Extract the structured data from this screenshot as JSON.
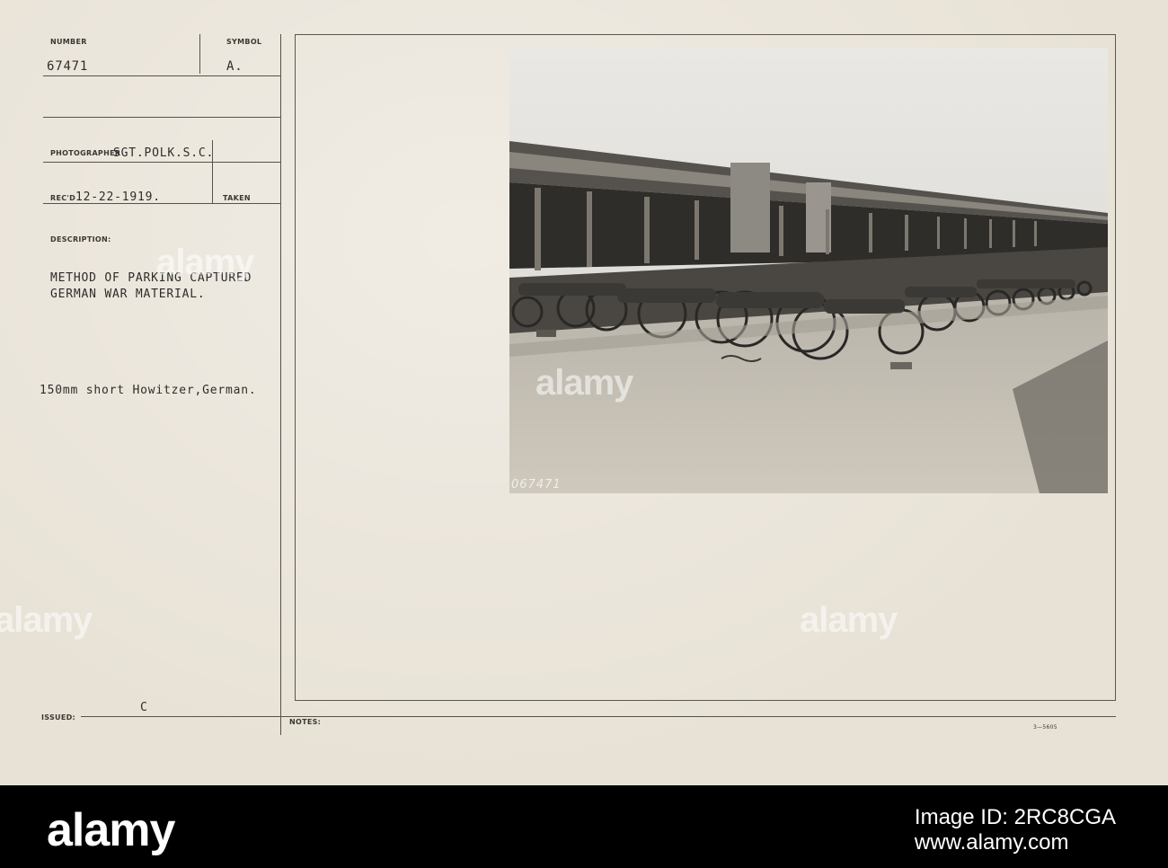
{
  "card": {
    "number_label": "NUMBER",
    "number_value": "67471",
    "symbol_label": "SYMBOL",
    "symbol_value": "A.",
    "photographer_label": "PHOTOGRAPHER",
    "photographer_value": "SGT.POLK.S.C.",
    "recd_label": "REC'D",
    "recd_value": "12-22-1919.",
    "taken_label": "TAKEN",
    "description_label": "DESCRIPTION:",
    "description_line1": "METHOD OF PARKING CAPTURED",
    "description_line2": "GERMAN WAR MATERIAL.",
    "subject": "150mm short Howitzer,German.",
    "issued_label": "ISSUED:",
    "issued_mark": "C",
    "notes_label": "NOTES:",
    "form_code": "3—5605"
  },
  "photo": {
    "negative_number": "067471"
  },
  "watermark": {
    "text": "alamy"
  },
  "footer": {
    "logo": "alamy",
    "image_id_label": "Image ID: 2RC8CGA",
    "site": "www.alamy.com"
  },
  "colors": {
    "card": "#e8e2d6",
    "ink": "#2e2d2a",
    "footer": "#000000"
  }
}
